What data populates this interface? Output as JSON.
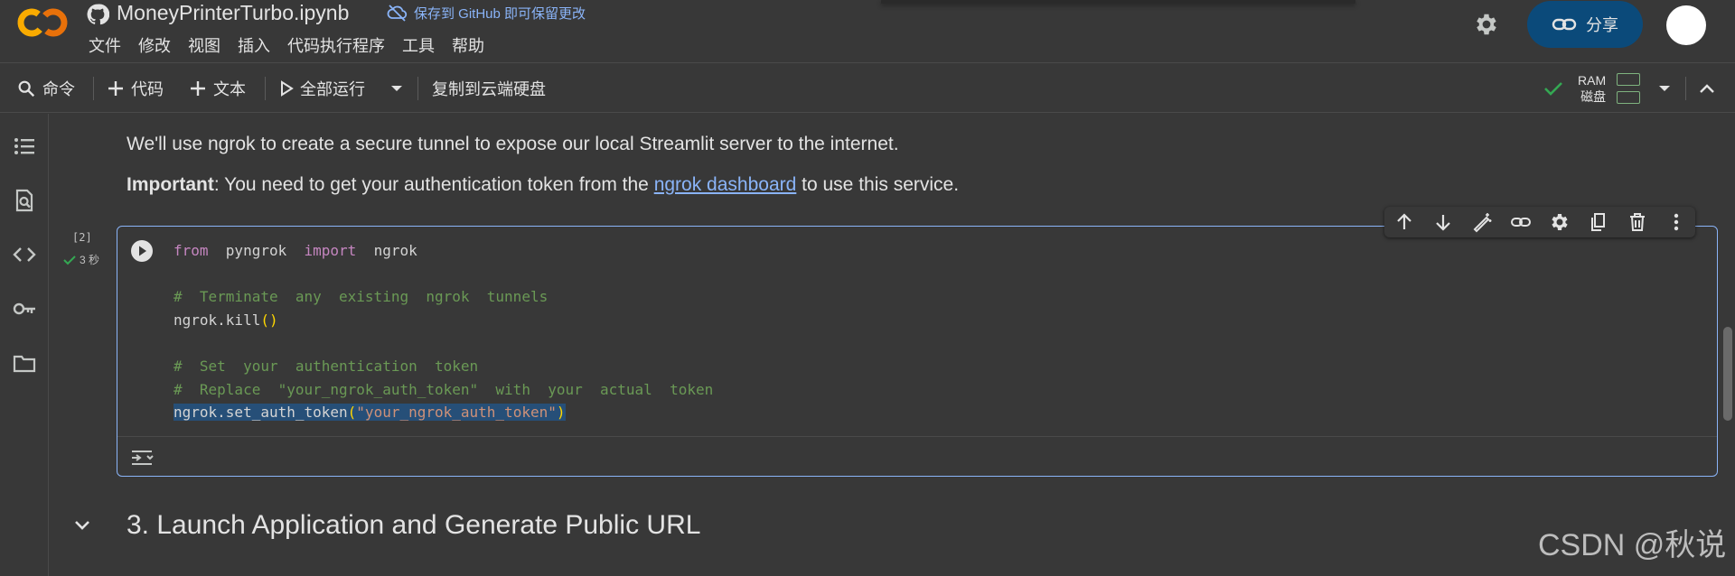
{
  "header": {
    "logo_text": "CO",
    "file_title": "MoneyPrinterTurbo.ipynb",
    "save_github": "保存到 GitHub 即可保留更改",
    "menu": [
      "文件",
      "修改",
      "视图",
      "插入",
      "代码执行程序",
      "工具",
      "帮助"
    ],
    "share_label": "分享"
  },
  "toolbar": {
    "command": "命令",
    "add_code": "代码",
    "add_text": "文本",
    "run_all": "全部运行",
    "copy_drive": "复制到云端硬盘",
    "ram_label": "RAM",
    "disk_label": "磁盘"
  },
  "content": {
    "intro_line": "We'll use ngrok to create a secure tunnel to expose our local Streamlit server to the internet.",
    "important_label": "Important",
    "important_text_before": ": You need to get your authentication token from the ",
    "important_link": "ngrok dashboard",
    "important_text_after": " to use this service.",
    "cell": {
      "execution_count": "[2]",
      "execution_time": "3 秒"
    },
    "section_heading": "3. Launch Application and Generate Public URL"
  },
  "watermark": "CSDN @秋说",
  "colors": {
    "background": "#383838",
    "accent": "#8ab4f8",
    "share_button": "#0b4a7a",
    "logo_orange": "#f9ab00",
    "success_green": "#34a853"
  },
  "icons": [
    "github-icon",
    "cloud-off-icon",
    "gear-icon",
    "link-icon",
    "search-icon",
    "plus-icon",
    "play-icon",
    "chevron-down-icon",
    "check-icon",
    "chevron-up-icon",
    "toc-icon",
    "find-icon",
    "code-icon",
    "key-icon",
    "folder-icon",
    "arrow-up-icon",
    "arrow-down-icon",
    "magic-edit-icon",
    "settings-icon",
    "mirror-icon",
    "trash-icon",
    "more-icon",
    "output-toggle-icon"
  ]
}
